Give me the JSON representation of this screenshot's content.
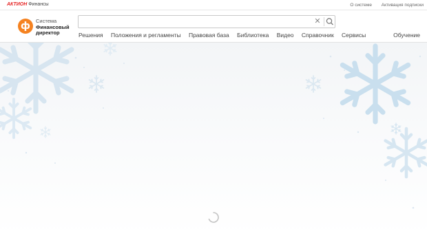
{
  "topbar": {
    "brand_red": "АКТИОН",
    "brand_rest": "Финансы",
    "links": [
      "О системе",
      "Активация подписки"
    ]
  },
  "logo": {
    "glyph": "ф",
    "lines": [
      "Система",
      "Финансовый",
      "директор"
    ],
    "color": "#f58220"
  },
  "search": {
    "value": "",
    "placeholder": "",
    "clear_glyph": "✕"
  },
  "nav": {
    "items": [
      "Решения",
      "Положения и регламенты",
      "Правовая база",
      "Библиотека",
      "Видео",
      "Справочник",
      "Сервисы"
    ],
    "right": "Обучение"
  },
  "colors": {
    "accent": "#f58220",
    "brand_red": "#e52222",
    "snowflake": "#cfe0ee"
  }
}
